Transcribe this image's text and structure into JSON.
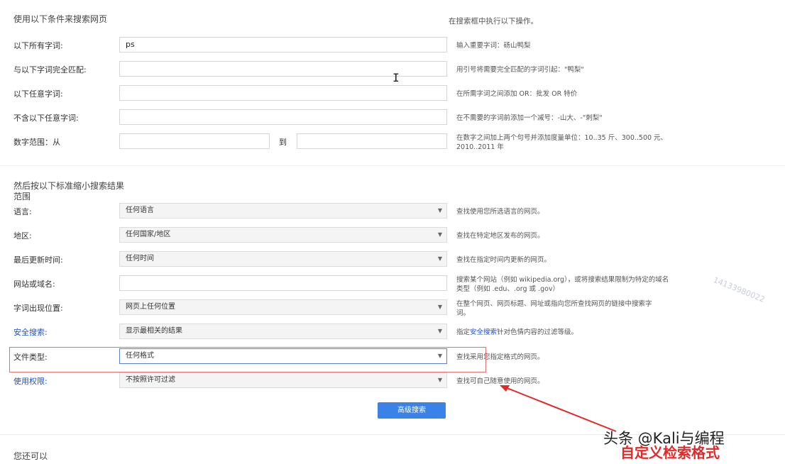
{
  "section1": {
    "title": "使用以下条件来搜索网页",
    "right_header": "在搜索框中执行以下操作。",
    "rows": [
      {
        "label": "以下所有字词:",
        "value": "ps",
        "hint": "输入重要字词：砀山鸭梨"
      },
      {
        "label": "与以下字词完全匹配:",
        "value": "",
        "hint": "用引号将需要完全匹配的字词引起：\"鸭梨\""
      },
      {
        "label": "以下任意字词:",
        "value": "",
        "hint": "在所需字词之间添加 OR：批发 OR 特价"
      },
      {
        "label": "不含以下任意字词:",
        "value": "",
        "hint": "在不需要的字词前添加一个减号：-山大、-\"刺梨\""
      },
      {
        "label": "数字范围：从",
        "to_label": "到",
        "value": "",
        "hint": "在数字之间加上两个句号并添加度量单位：10..35 斤、300..500 元、2010..2011 年"
      }
    ]
  },
  "section2": {
    "title": "然后按以下标准缩小搜索结果范围",
    "rows": [
      {
        "label": "语言:",
        "value": "任何语言",
        "hint": "查找使用您所选语言的网页。"
      },
      {
        "label": "地区:",
        "value": "任何国家/地区",
        "hint": "查找在特定地区发布的网页。"
      },
      {
        "label": "最后更新时间:",
        "value": "任何时间",
        "hint": "查找在指定时间内更新的网页。"
      },
      {
        "label": "网站或域名:",
        "value": "",
        "hint": "搜索某个网站（例如 wikipedia.org），或将搜索结果限制为特定的域名类型（例如 .edu、.org 或 .gov）"
      },
      {
        "label": "字词出现位置:",
        "value": "网页上任何位置",
        "hint": "在整个网页、网页标题、网址或指向您所查找网页的链接中搜索字词。"
      },
      {
        "label": "安全搜索:",
        "value": "显示最相关的结果",
        "hint_prefix": "指定",
        "hint_link": "安全搜索",
        "hint_suffix": "针对色情内容的过滤等级。"
      },
      {
        "label": "文件类型:",
        "value": "任何格式",
        "hint": "查找采用您指定格式的网页。"
      },
      {
        "label": "使用权限:",
        "value": "不按照许可过滤",
        "hint": "查找可自己随意使用的网页。"
      }
    ],
    "submit_label": "高级搜索"
  },
  "bottom_title": "您还可以",
  "watermark": "14133980022",
  "brand_text": "头条 @Kali与编程",
  "annotation_text": "自定义检索格式",
  "accent_color": "#3b82e8",
  "annotation_color": "#e52828"
}
